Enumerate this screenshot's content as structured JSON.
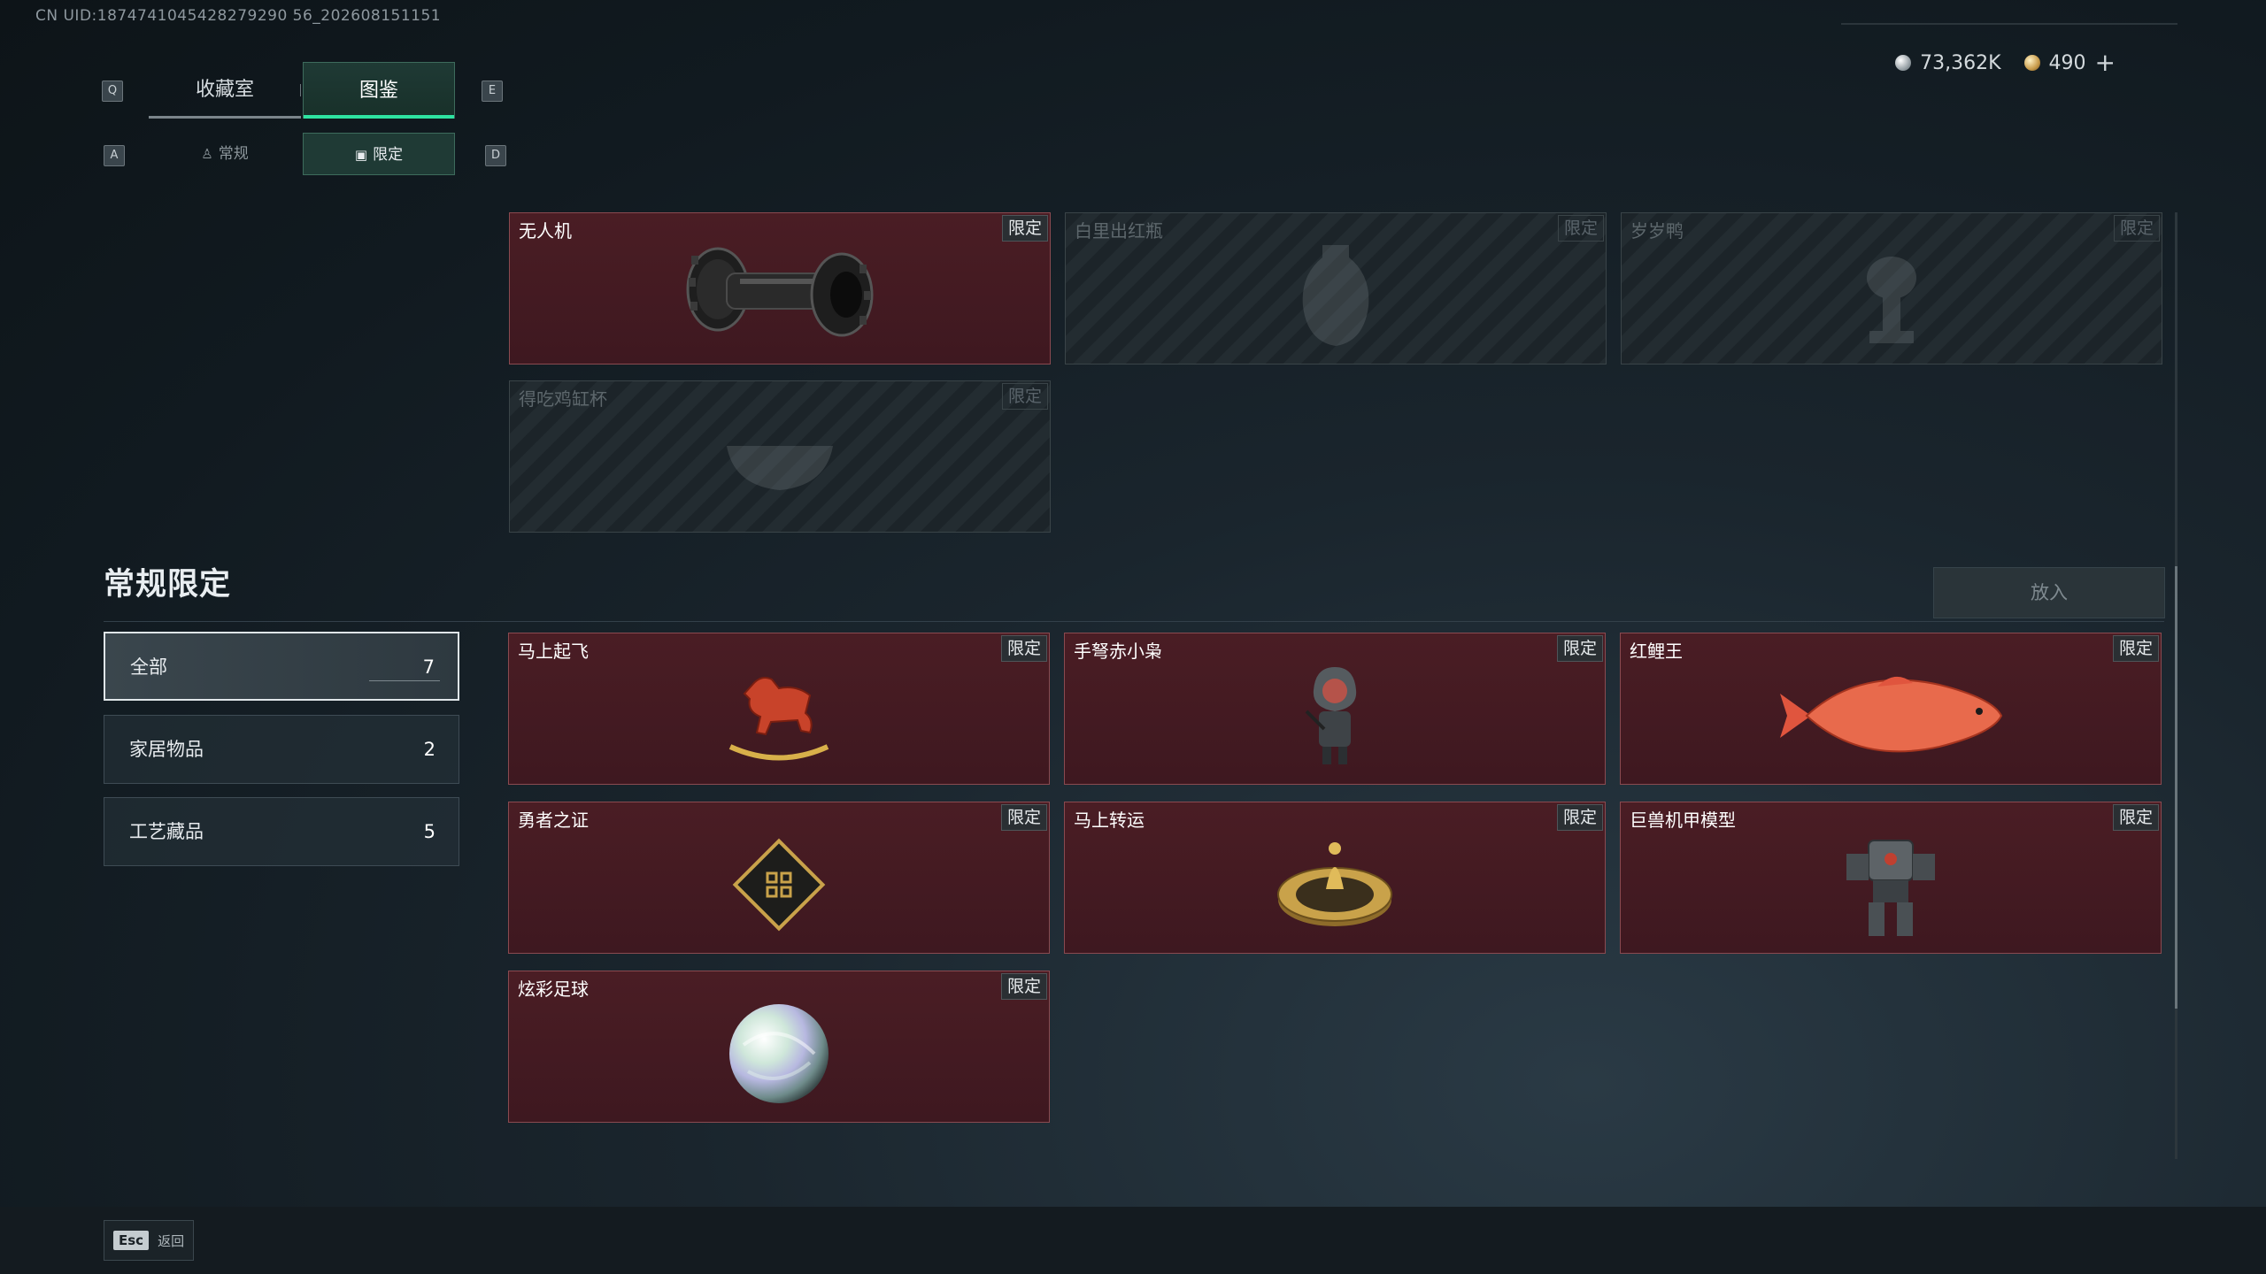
{
  "uid": "CN UID:1874741045428279290 56_202608151151",
  "tabs": {
    "left_key": "Q",
    "right_key": "E",
    "items": [
      "收藏室",
      "图鉴"
    ]
  },
  "subtabs": {
    "left_key": "A",
    "right_key": "D",
    "items": [
      "常规",
      "限定"
    ]
  },
  "currency": {
    "silver": "73,362K",
    "gold": "490",
    "plus": "+"
  },
  "top_items": [
    {
      "name": "无人机",
      "badge": "限定",
      "unlocked": true,
      "icon": "drone-roller-icon"
    },
    {
      "name": "白里出红瓶",
      "badge": "限定",
      "unlocked": false,
      "icon": "vase-icon"
    },
    {
      "name": "岁岁鸭",
      "badge": "限定",
      "unlocked": false,
      "icon": "duck-trophy-icon"
    },
    {
      "name": "得吃鸡缸杯",
      "badge": "限定",
      "unlocked": false,
      "icon": "bowl-icon"
    }
  ],
  "section": {
    "title": "常规限定",
    "put_button": "放入"
  },
  "categories": [
    {
      "label": "全部",
      "count": "7"
    },
    {
      "label": "家居物品",
      "count": "2"
    },
    {
      "label": "工艺藏品",
      "count": "5"
    }
  ],
  "items": [
    {
      "name": "马上起飞",
      "badge": "限定",
      "icon": "rocking-horse-icon"
    },
    {
      "name": "手弩赤小枭",
      "badge": "限定",
      "icon": "hooded-figure-icon"
    },
    {
      "name": "红鲤王",
      "badge": "限定",
      "icon": "red-carp-icon"
    },
    {
      "name": "勇者之证",
      "badge": "限定",
      "icon": "badge-card-icon"
    },
    {
      "name": "马上转运",
      "badge": "限定",
      "icon": "golden-compass-icon"
    },
    {
      "name": "巨兽机甲模型",
      "badge": "限定",
      "icon": "mech-model-icon"
    },
    {
      "name": "炫彩足球",
      "badge": "限定",
      "icon": "iridescent-ball-icon"
    }
  ],
  "footer": {
    "key": "Esc",
    "label": "返回"
  }
}
